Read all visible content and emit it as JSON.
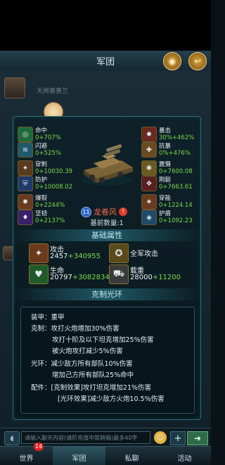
{
  "header": {
    "title": "军团",
    "coin_icon": "coin-icon",
    "back_icon": "back-icon"
  },
  "chat": {
    "partial_line": "天闹喜喜兰"
  },
  "tank": {
    "level": "11",
    "name": "龙卷风",
    "count": "基前数量:1"
  },
  "stats_left": [
    {
      "name": "命中",
      "value": "0+707%",
      "icon": "target-icon",
      "color": "#1f6a3a"
    },
    {
      "name": "闪避",
      "value": "0+525%",
      "icon": "dodge-icon",
      "color": "#1f5a6a"
    },
    {
      "name": "穿刺",
      "value": "0+10030.39",
      "icon": "pierce-icon",
      "color": "#5a3a1f"
    },
    {
      "name": "防护",
      "value": "0+10008.02",
      "icon": "shield-icon",
      "color": "#1f3a6a"
    },
    {
      "name": "爆裂",
      "value": "0+2244%",
      "icon": "burst-icon",
      "color": "#6a3a1f"
    },
    {
      "name": "坚韧",
      "value": "0+2137%",
      "icon": "tough-icon",
      "color": "#3a1f6a"
    }
  ],
  "stats_right": [
    {
      "name": "暴击",
      "value": "30%+462%",
      "icon": "crit-icon",
      "color": "#6a2a1f"
    },
    {
      "name": "抗暴",
      "value": "0%+476%",
      "icon": "anticrit-icon",
      "color": "#6a4a1f"
    },
    {
      "name": "震慑",
      "value": "0+7600.08",
      "icon": "shock-icon",
      "color": "#6a5a1f"
    },
    {
      "name": "刚毅",
      "value": "0+7663.61",
      "icon": "firm-icon",
      "color": "#5a1f1f"
    },
    {
      "name": "穿能",
      "value": "0+1224.14",
      "icon": "energy-icon",
      "color": "#6a3a1f"
    },
    {
      "name": "护盾",
      "value": "0+1092.23",
      "icon": "barrier-icon",
      "color": "#1f4a6a"
    }
  ],
  "basic": {
    "section_title": "基础属性",
    "attack_label": "攻击",
    "attack_base": "2457",
    "attack_bonus": "+340955",
    "army_attack_label": "全军攻击",
    "hp_label": "生命",
    "hp_base": "20797",
    "hp_bonus": "+3082834",
    "load_label": "载重",
    "load_base": "28000",
    "load_bonus": "+11200"
  },
  "halo": {
    "section_title": "克制光环",
    "lines": [
      "装甲：重甲",
      "克制：攻打火炮增加30%伤害",
      "攻打十阶及以下坦克增加25%伤害",
      "被火炮攻打减少5%伤害",
      "光环：减少敌方所有部队10%伤害",
      "增加己方所有部队25%命中",
      "配件：[克制效果]攻打坦克增加21%伤害",
      "[光环效果]减少敌方火炮10.5%伤害"
    ]
  },
  "input": {
    "placeholder": "请输入聊天内容(请阶充值中禁跨输)最多40字"
  },
  "tabs": [
    {
      "label": "世界",
      "badge": "14"
    },
    {
      "label": "军团",
      "badge": ""
    },
    {
      "label": "私聊",
      "badge": ""
    },
    {
      "label": "活动",
      "badge": ""
    }
  ]
}
